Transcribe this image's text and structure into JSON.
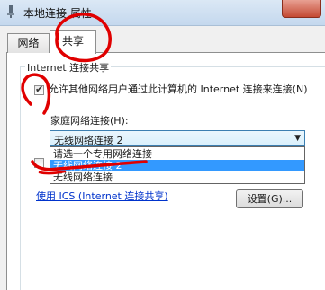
{
  "window": {
    "title": "本地连接 属性"
  },
  "tabs": [
    {
      "label": "网络"
    },
    {
      "label": "共享"
    }
  ],
  "sharing": {
    "group_title": "Internet 连接共享",
    "allow_label": "允许其他网络用户通过此计算机的 Internet 连接来连接(N)",
    "allow_checked": true,
    "home_network_label": "家庭网络连接(H):",
    "dropdown_value": "无线网络连接 2",
    "dropdown_options": [
      "请选一个专用网络连接",
      "无线网络连接 2",
      "无线网络连接"
    ],
    "selected_option_index": 1,
    "ics_link": "使用 ICS (Internet 连接共享)",
    "settings_button": "设置(G)..."
  },
  "annotation_color": "#e00000"
}
